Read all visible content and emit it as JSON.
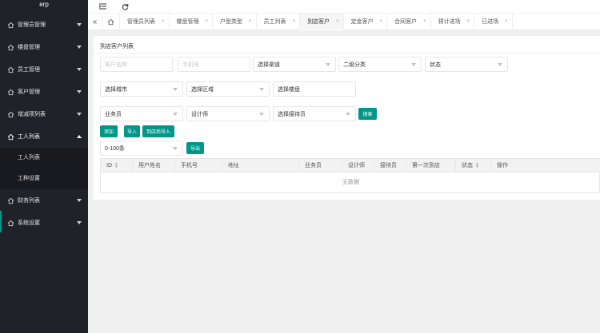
{
  "sidebar": {
    "logo": "erp",
    "items": [
      {
        "label": "管理员管理"
      },
      {
        "label": "楼盘管理"
      },
      {
        "label": "员工管理"
      },
      {
        "label": "客户管理"
      },
      {
        "label": "增减项列表"
      },
      {
        "label": "工人列表"
      },
      {
        "label": "财务列表"
      },
      {
        "label": "系统设置"
      }
    ],
    "subitems": [
      {
        "label": "工人列表"
      },
      {
        "label": "工种设置"
      }
    ]
  },
  "tabs": [
    {
      "label": "管理员列表"
    },
    {
      "label": "楼盘管理"
    },
    {
      "label": "户型类型"
    },
    {
      "label": "员工列表"
    },
    {
      "label": "到店客户"
    },
    {
      "label": "定金客户"
    },
    {
      "label": "合同客户"
    },
    {
      "label": "预计进场"
    },
    {
      "label": "已进场"
    }
  ],
  "tab_close": "×",
  "card": {
    "title": "到店客户列表"
  },
  "filters": {
    "customer_name_placeholder": "客户名称",
    "phone_placeholder": "手机号",
    "channel": "选择渠道",
    "category2": "二级分类",
    "status": "状态",
    "city": "选择城市",
    "district": "选择区域",
    "building": "选择楼盘",
    "salesman": "业务员",
    "designer": "设计师",
    "receptionist": "选择接待员",
    "page_size": "0-100条"
  },
  "buttons": {
    "search": "搜索",
    "add": "添加",
    "import": "导入",
    "import_after_visit": "到店后导入",
    "export": "导出"
  },
  "table": {
    "columns": [
      "ID",
      "用户姓名",
      "手机号",
      "地址",
      "业务员",
      "设计师",
      "接待员",
      "第一次到店",
      "状态",
      "操作"
    ],
    "empty_text": "无数据"
  }
}
